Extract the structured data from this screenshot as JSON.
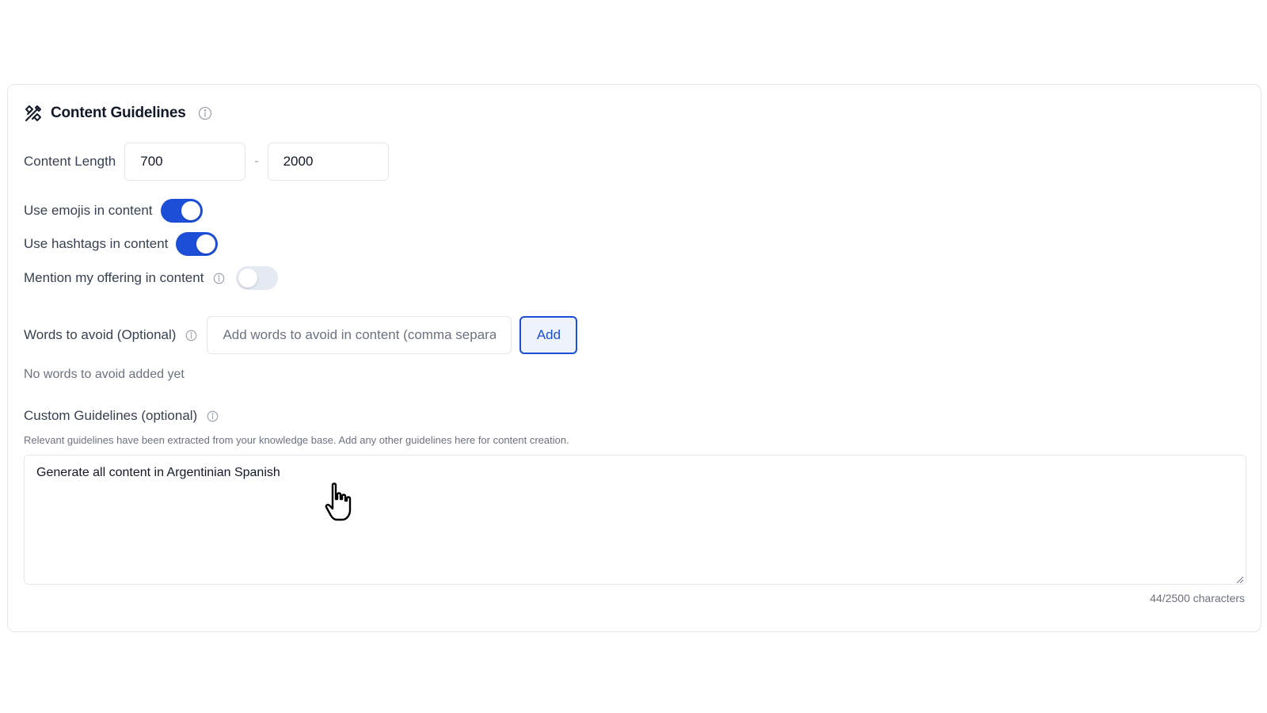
{
  "card": {
    "title": "Content Guidelines",
    "icons": {
      "brand": "design-tools-icon",
      "info": "info-icon"
    }
  },
  "content_length": {
    "label": "Content Length",
    "min_value": "700",
    "max_value": "2000",
    "separator": "-"
  },
  "toggles": {
    "emojis": {
      "label": "Use emojis in content",
      "enabled": true
    },
    "hashtags": {
      "label": "Use hashtags in content",
      "enabled": true
    },
    "offering": {
      "label": "Mention my offering in content",
      "enabled": false
    }
  },
  "words_to_avoid": {
    "label": "Words to avoid (Optional)",
    "placeholder": "Add words to avoid in content (comma separated)",
    "add_label": "Add",
    "empty_message": "No words to avoid added yet"
  },
  "custom_guidelines": {
    "label": "Custom Guidelines (optional)",
    "description": "Relevant guidelines have been extracted from your knowledge base. Add any other guidelines here for content creation.",
    "value": "Generate all content in Argentinian Spanish",
    "char_count": "44/2500 characters"
  },
  "colors": {
    "accent": "#1d4ed8",
    "toggle_off": "#e5eaf2",
    "border": "#e5e7eb",
    "muted_text": "#6b7280"
  }
}
